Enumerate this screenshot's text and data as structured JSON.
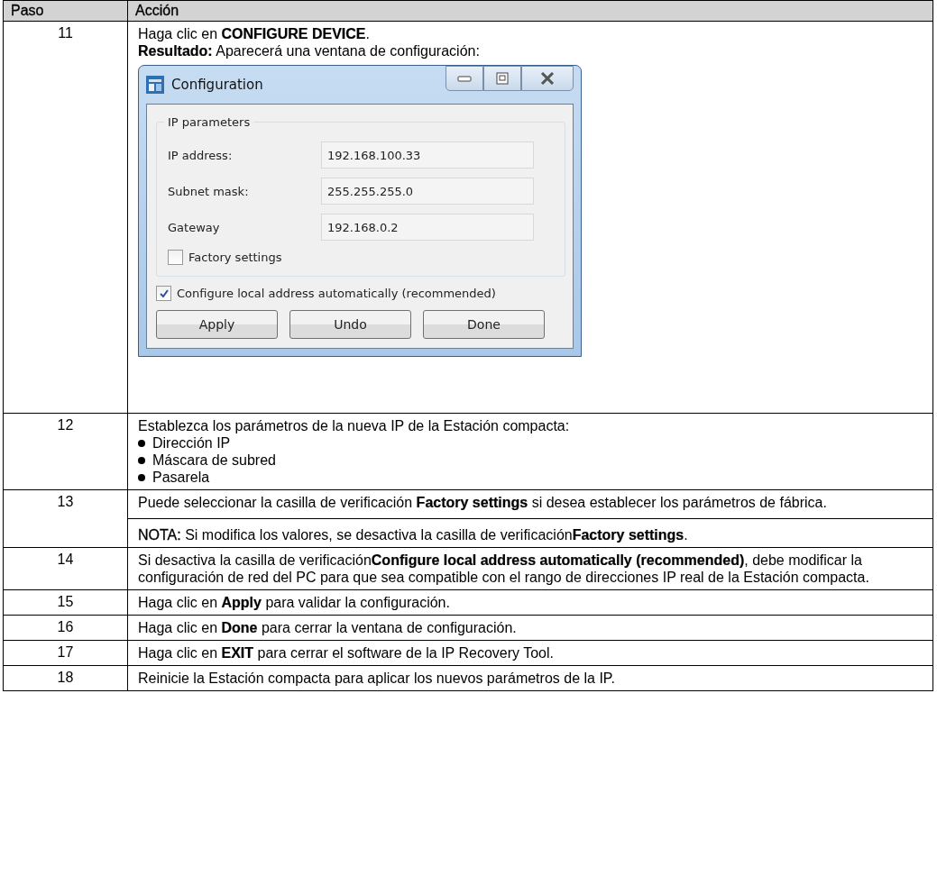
{
  "table": {
    "columns": [
      "Paso",
      "Acción"
    ],
    "rows": [
      {
        "step": "11",
        "blocks": [
          {
            "kind": "paragraph",
            "text": "Haga clic en **CONFIGURE DEVICE**."
          },
          {
            "kind": "paragraph",
            "text": "**Resultado:** Aparecerá una ventana de configuración:"
          },
          {
            "kind": "dialog",
            "dialog": {
              "title": "Configuration",
              "group": "IP parameters",
              "fields": [
                {
                  "label": "IP address:",
                  "value": "192.168.100.33"
                },
                {
                  "label": "Subnet mask:",
                  "value": "255.255.255.0"
                },
                {
                  "label": "Gateway",
                  "value": "192.168.0.2"
                }
              ],
              "factory": {
                "label": "Factory settings",
                "checked": false
              },
              "auto": {
                "label": "Configure local address automatically (recommended)",
                "checked": true
              },
              "buttons": [
                "Apply",
                "Undo",
                "Done"
              ]
            }
          }
        ]
      },
      {
        "step": "12",
        "blocks": [
          {
            "kind": "paragraph",
            "text": "Establezca los parámetros de la nueva IP de la Estación compacta:"
          },
          {
            "kind": "bullets",
            "items": [
              "Dirección IP",
              "Máscara de subred",
              "Pasarela"
            ]
          }
        ]
      },
      {
        "step": "13",
        "blocks": [
          {
            "kind": "paragraph",
            "text": "Puede seleccionar la casilla de verificación **Factory settings** si desea establecer los parámetros de fábrica."
          },
          {
            "kind": "note",
            "text": "**NOTA:** Si modifica los valores, se desactiva la casilla de verificación**Factory settings**."
          }
        ]
      },
      {
        "step": "14",
        "blocks": [
          {
            "kind": "paragraph",
            "text": "Si desactiva la casilla de verificación**Configure local address automatically (recommended)**, debe modificar la configuración de red del PC para que sea compatible con el rango de direcciones IP real de la Estación compacta."
          }
        ]
      },
      {
        "step": "15",
        "blocks": [
          {
            "kind": "paragraph",
            "text": "Haga clic en **Apply** para validar la configuración."
          }
        ]
      },
      {
        "step": "16",
        "blocks": [
          {
            "kind": "paragraph",
            "text": "Haga clic en **Done** para cerrar la ventana de configuración."
          }
        ]
      },
      {
        "step": "17",
        "blocks": [
          {
            "kind": "paragraph",
            "text": "Haga clic en **EXIT** para cerrar el software de la IP Recovery Tool."
          }
        ]
      },
      {
        "step": "18",
        "blocks": [
          {
            "kind": "paragraph",
            "text": "Reinicie la Estación compacta para aplicar los nuevos parámetros de la IP."
          }
        ]
      }
    ]
  }
}
